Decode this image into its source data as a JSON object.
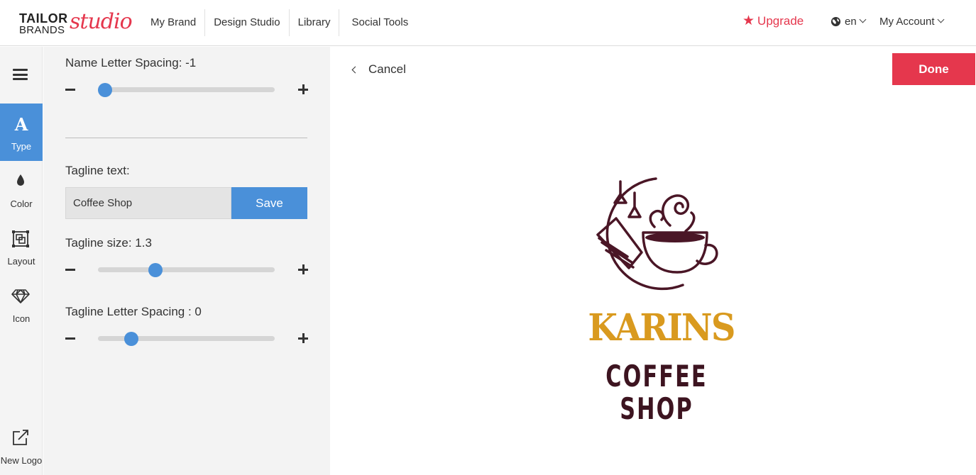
{
  "brand": {
    "line1": "TAILOR",
    "line2": "BRANDS",
    "script": "studio",
    "accent": "#e5374d"
  },
  "nav": {
    "items": [
      {
        "label": "My Brand"
      },
      {
        "label": "Design Studio"
      },
      {
        "label": "Library"
      },
      {
        "label": "Social Tools"
      }
    ]
  },
  "header": {
    "upgrade_label": "Upgrade",
    "language": "en",
    "account_label": "My Account"
  },
  "rail": {
    "active_color": "#4a90d9",
    "items": [
      {
        "label": "Type",
        "icon": "type-icon",
        "active": true
      },
      {
        "label": "Color",
        "icon": "drop-icon",
        "active": false
      },
      {
        "label": "Layout",
        "icon": "layout-icon",
        "active": false
      },
      {
        "label": "Icon",
        "icon": "diamond-icon",
        "active": false
      }
    ],
    "new_logo_label": "New Logo"
  },
  "panel": {
    "name_spacing": {
      "label": "Name Letter Spacing: -1",
      "fraction": 0.04
    },
    "tagline_text": {
      "label": "Tagline text:",
      "value": "Coffee Shop",
      "save_label": "Save"
    },
    "tagline_size": {
      "label": "Tagline size: 1.3",
      "fraction": 0.325
    },
    "tagline_spacing": {
      "label": "Tagline Letter Spacing : 0",
      "fraction": 0.19
    }
  },
  "canvas": {
    "cancel_label": "Cancel",
    "done_label": "Done",
    "logo": {
      "name": "KARINS",
      "tagline": "COFFEE SHOP",
      "name_color": "#d99a1f",
      "mark_color": "#4a1626"
    }
  }
}
